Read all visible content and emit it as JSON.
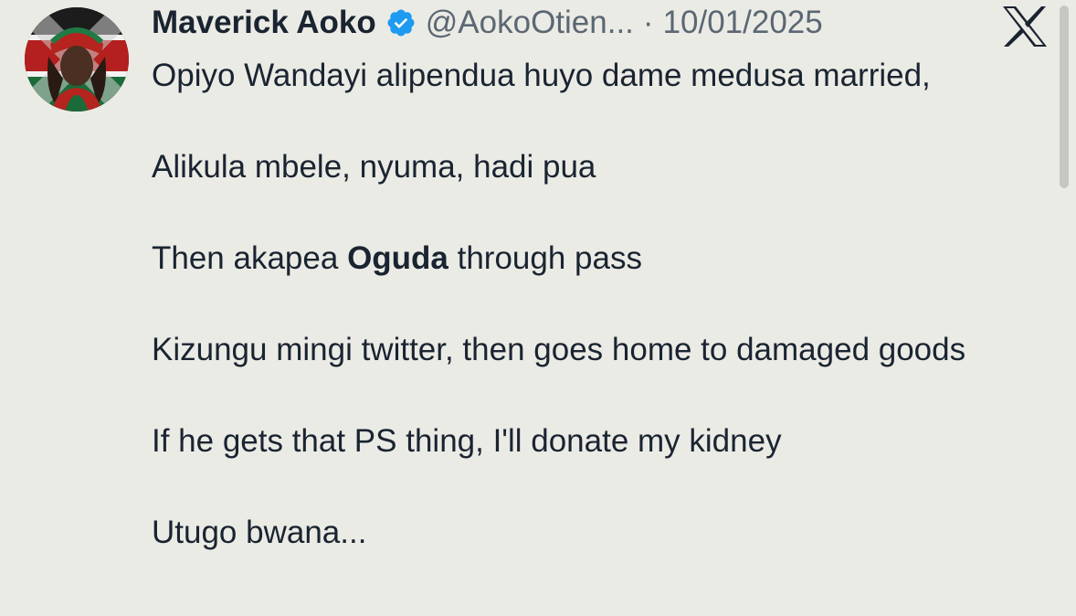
{
  "tweet": {
    "author_name": "Maverick Aoko",
    "handle": "@AokoOtien...",
    "separator": "·",
    "date": "10/01/2025",
    "verified_icon": "verified-badge-icon",
    "brand_icon": "x-logo-icon",
    "avatar_alt": "profile avatar",
    "body": {
      "line1": "Opiyo Wandayi alipendua huyo dame medusa married,",
      "line2": "Alikula mbele, nyuma, hadi pua",
      "line3_before": "Then akapea ",
      "line3_bold": "Oguda",
      "line3_after": " through pass",
      "line4": "Kizungu mingi twitter, then goes home to damaged goods",
      "line5": "If he gets that PS thing, I'll donate my kidney",
      "line6": "Utugo bwana..."
    }
  },
  "colors": {
    "background": "#ebebe5",
    "text": "#1a2431",
    "muted": "#5b6773",
    "verified": "#1d9bf0"
  }
}
